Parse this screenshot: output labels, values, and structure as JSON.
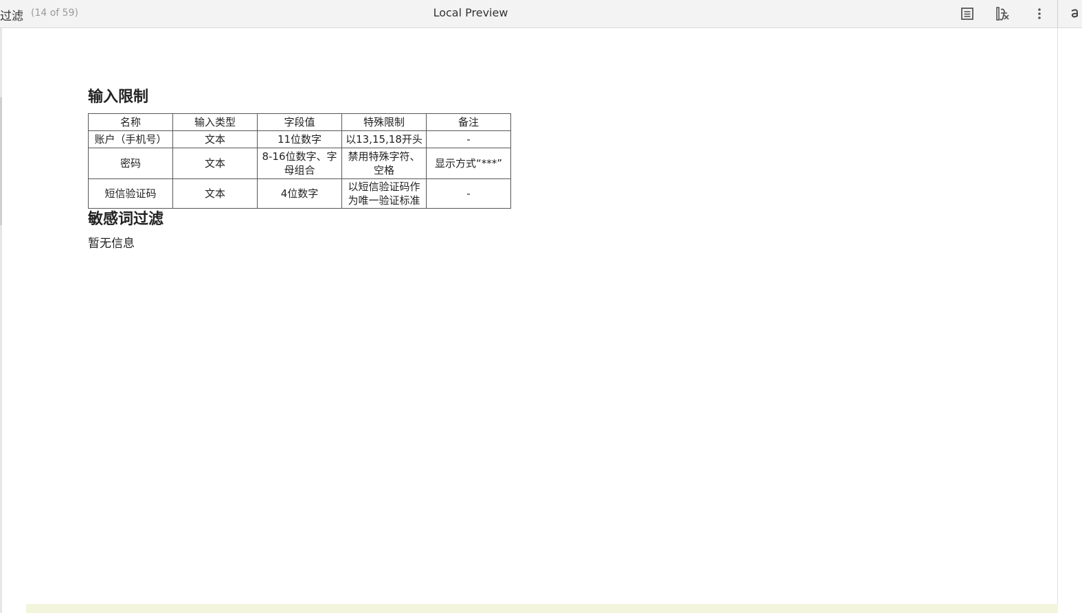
{
  "toolbar": {
    "title": "过滤",
    "count": "(14 of 59)",
    "center_title": "Local Preview",
    "icons": [
      "document-icon",
      "formula-icon",
      "more-vertical-icon"
    ]
  },
  "sections": {
    "input_limits": {
      "heading": "输入限制",
      "table": {
        "headers": [
          "名称",
          "输入类型",
          "字段值",
          "特殊限制",
          "备注"
        ],
        "rows": [
          [
            "账户（手机号）",
            "文本",
            "11位数字",
            "以13,15,18开头",
            "-"
          ],
          [
            "密码",
            "文本",
            "8-16位数字、字母组合",
            "禁用特殊字符、空格",
            "显示方式“***”"
          ],
          [
            "短信验证码",
            "文本",
            "4位数字",
            "以短信验证码作为唯一验证标准",
            "-"
          ]
        ]
      }
    },
    "sensitive_filter": {
      "heading": "敏感词过滤",
      "body": "暂无信息"
    }
  }
}
